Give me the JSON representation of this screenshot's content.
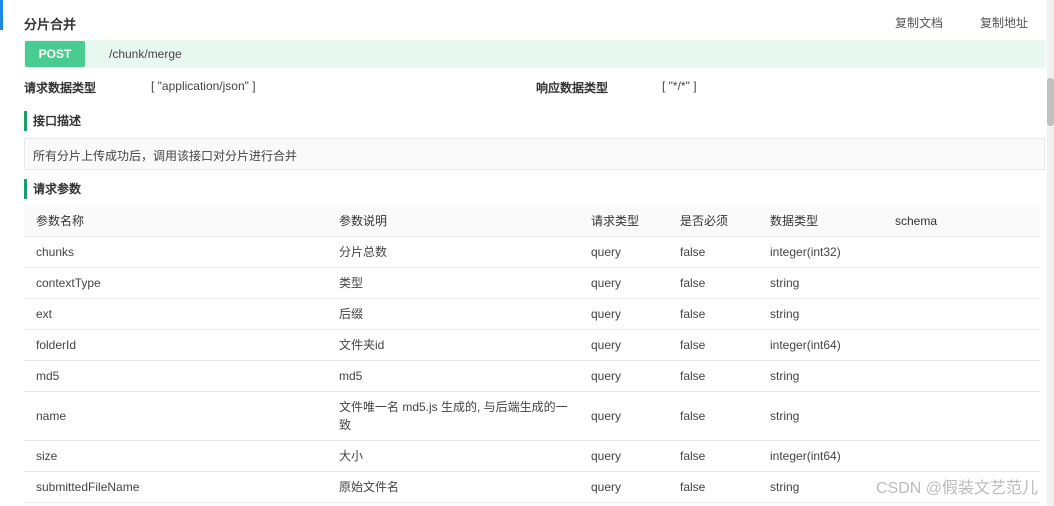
{
  "header": {
    "title": "分片合并",
    "copy_doc": "复制文档",
    "copy_url": "复制地址"
  },
  "endpoint": {
    "method": "POST",
    "path": "/chunk/merge"
  },
  "request_type": {
    "label": "请求数据类型",
    "value": "[ \"application/json\" ]"
  },
  "response_type": {
    "label": "响应数据类型",
    "value": "[ \"*/*\" ]"
  },
  "description": {
    "title": "接口描述",
    "text": "所有分片上传成功后，调用该接口对分片进行合并"
  },
  "params": {
    "title": "请求参数",
    "columns": [
      "参数名称",
      "参数说明",
      "请求类型",
      "是否必须",
      "数据类型",
      "schema"
    ],
    "rows": [
      {
        "name": "chunks",
        "desc": "分片总数",
        "in": "query",
        "required": "false",
        "type": "integer(int32)",
        "schema": ""
      },
      {
        "name": "contextType",
        "desc": "类型",
        "in": "query",
        "required": "false",
        "type": "string",
        "schema": ""
      },
      {
        "name": "ext",
        "desc": "后缀",
        "in": "query",
        "required": "false",
        "type": "string",
        "schema": ""
      },
      {
        "name": "folderId",
        "desc": "文件夹id",
        "in": "query",
        "required": "false",
        "type": "integer(int64)",
        "schema": ""
      },
      {
        "name": "md5",
        "desc": "md5",
        "in": "query",
        "required": "false",
        "type": "string",
        "schema": ""
      },
      {
        "name": "name",
        "desc": "文件唯一名 md5.js 生成的, 与后端生成的一致",
        "in": "query",
        "required": "false",
        "type": "string",
        "schema": ""
      },
      {
        "name": "size",
        "desc": "大小",
        "in": "query",
        "required": "false",
        "type": "integer(int64)",
        "schema": ""
      },
      {
        "name": "submittedFileName",
        "desc": "原始文件名",
        "in": "query",
        "required": "false",
        "type": "string",
        "schema": ""
      }
    ]
  },
  "watermark": "CSDN @假装文艺范儿",
  "colors": {
    "post": "#49cc90",
    "post_bg": "#e9f7f1",
    "accent": "#1a9e6b",
    "query": "#4a90e2"
  }
}
